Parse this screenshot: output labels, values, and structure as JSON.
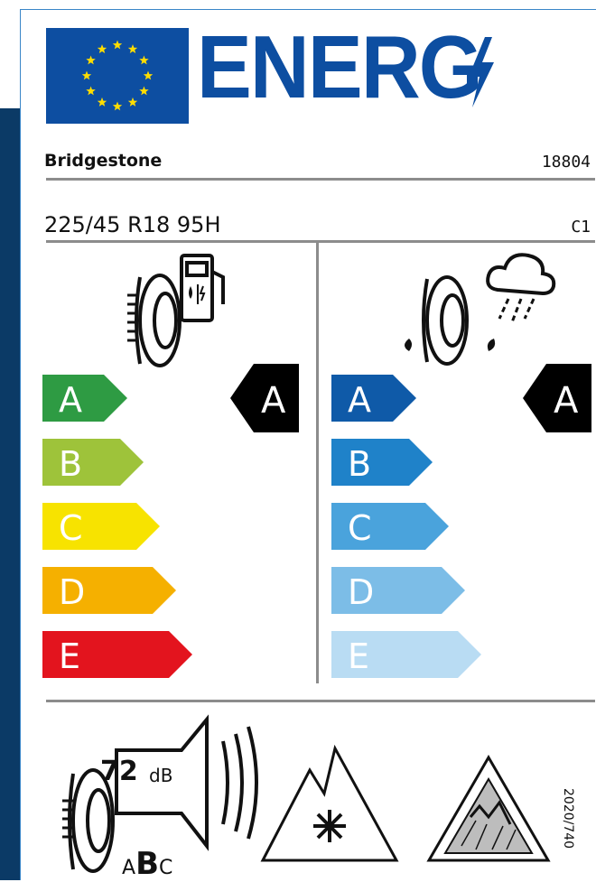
{
  "header": {
    "energy_word": "ENERG"
  },
  "supplier": {
    "name": "Bridgestone",
    "type_id": "18804"
  },
  "tyre": {
    "size_designation": "225/45 R18 95H",
    "tyre_class": "C1"
  },
  "fuel_efficiency": {
    "classes": [
      "A",
      "B",
      "C",
      "D",
      "E"
    ],
    "colors": [
      "#2e9b43",
      "#9ec33a",
      "#f7e300",
      "#f5b000",
      "#e3141e"
    ],
    "rating": "A"
  },
  "wet_grip": {
    "classes": [
      "A",
      "B",
      "C",
      "D",
      "E"
    ],
    "colors": [
      "#0f5aa8",
      "#1f82c9",
      "#4aa3dc",
      "#7cbde7",
      "#b9dcf3"
    ],
    "rating": "A"
  },
  "noise": {
    "value": "72",
    "unit": "dB",
    "classes": [
      "A",
      "B",
      "C"
    ],
    "selected": "B"
  },
  "regulation": "2020/740"
}
